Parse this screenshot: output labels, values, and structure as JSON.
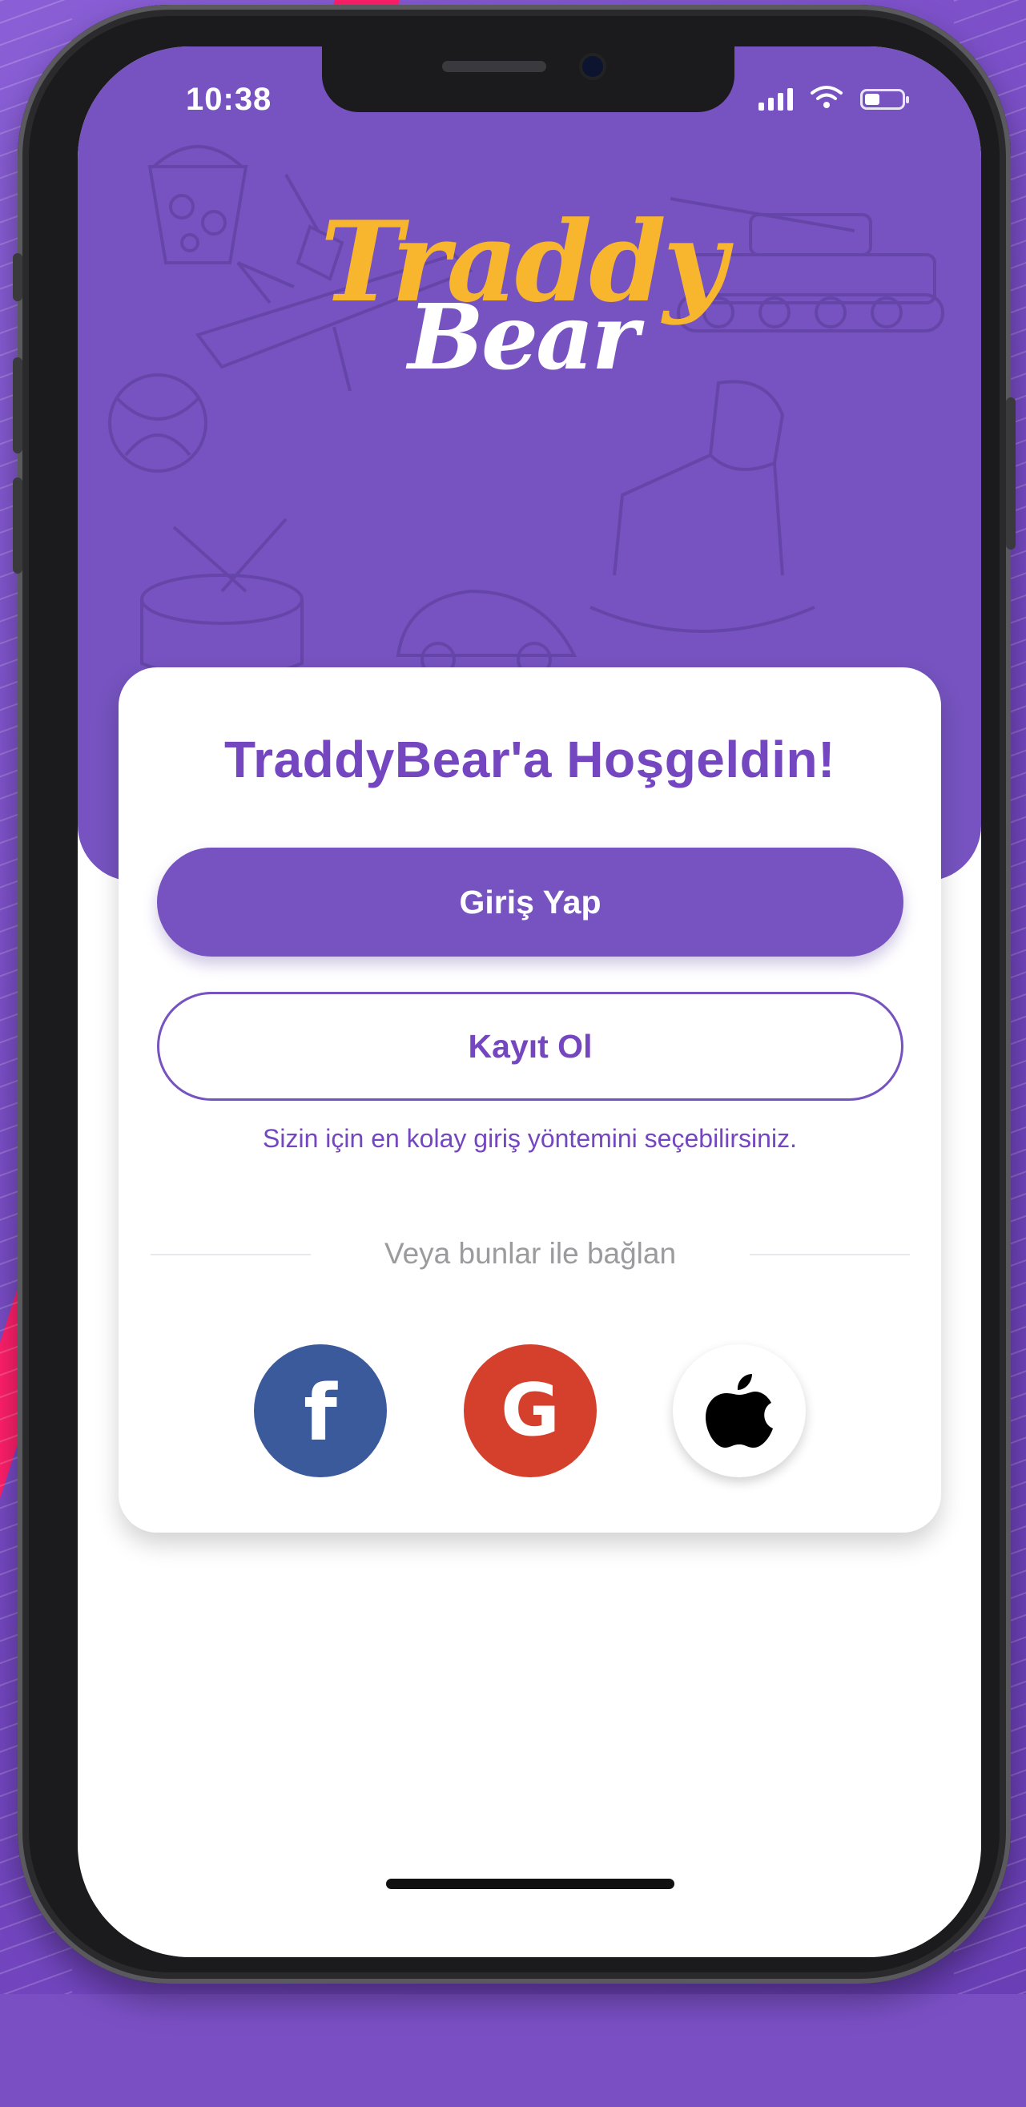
{
  "status_bar": {
    "time": "10:38",
    "icons": [
      "cellular-signal-icon",
      "wifi-icon",
      "battery-icon"
    ],
    "battery_level": 0.4
  },
  "hero": {
    "brand_top": "Traddy",
    "brand_bottom": "Bear"
  },
  "card": {
    "welcome_title": "TraddyBear'a Hoşgeldin!",
    "login_label": "Giriş Yap",
    "register_label": "Kayıt Ol",
    "hint_text": "Sizin için en kolay giriş yöntemini seçebilirsiniz.",
    "divider_text": "Veya bunlar ile bağlan",
    "social": [
      {
        "name": "facebook-icon",
        "color": "#3a5a9b"
      },
      {
        "name": "google-icon",
        "color": "#d4402c"
      },
      {
        "name": "apple-icon",
        "color": "#ffffff"
      }
    ]
  },
  "colors": {
    "primary": "#7653c0",
    "brand_yellow": "#f7b62d",
    "hint_text": "#7446c0",
    "divider_text": "#9b9b9e"
  }
}
